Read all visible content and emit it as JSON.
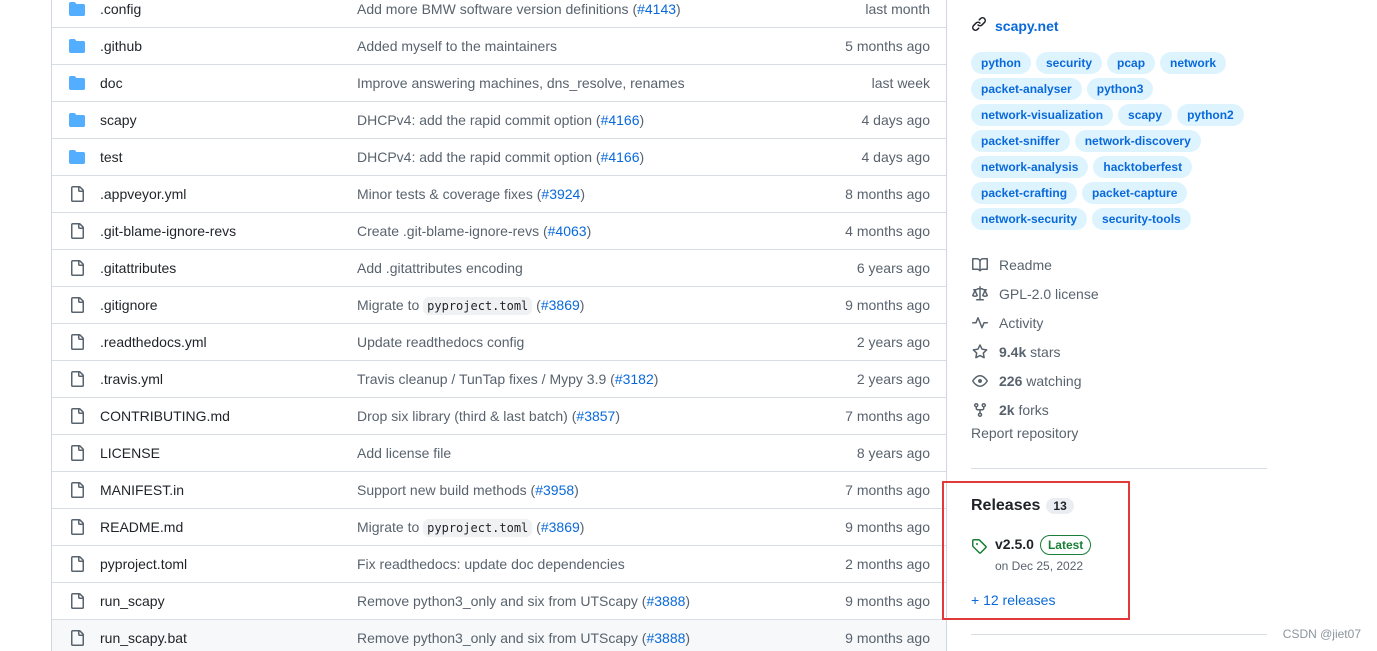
{
  "files": [
    {
      "type": "folder",
      "name": ".config",
      "msg_pre": "Add more BMW software version definitions (",
      "link": "#4143",
      "msg_post": ")",
      "code": "",
      "time": "last month"
    },
    {
      "type": "folder",
      "name": ".github",
      "msg_pre": "Added myself to the maintainers",
      "link": "",
      "msg_post": "",
      "code": "",
      "time": "5 months ago"
    },
    {
      "type": "folder",
      "name": "doc",
      "msg_pre": "Improve answering machines, dns_resolve, renames",
      "link": "",
      "msg_post": "",
      "code": "",
      "time": "last week"
    },
    {
      "type": "folder",
      "name": "scapy",
      "msg_pre": "DHCPv4: add the rapid commit option (",
      "link": "#4166",
      "msg_post": ")",
      "code": "",
      "time": "4 days ago"
    },
    {
      "type": "folder",
      "name": "test",
      "msg_pre": "DHCPv4: add the rapid commit option (",
      "link": "#4166",
      "msg_post": ")",
      "code": "",
      "time": "4 days ago"
    },
    {
      "type": "file",
      "name": ".appveyor.yml",
      "msg_pre": "Minor tests & coverage fixes (",
      "link": "#3924",
      "msg_post": ")",
      "code": "",
      "time": "8 months ago"
    },
    {
      "type": "file",
      "name": ".git-blame-ignore-revs",
      "msg_pre": "Create .git-blame-ignore-revs (",
      "link": "#4063",
      "msg_post": ")",
      "code": "",
      "time": "4 months ago"
    },
    {
      "type": "file",
      "name": ".gitattributes",
      "msg_pre": "Add .gitattributes encoding",
      "link": "",
      "msg_post": "",
      "code": "",
      "time": "6 years ago"
    },
    {
      "type": "file",
      "name": ".gitignore",
      "msg_pre": "Migrate to ",
      "code": "pyproject.toml",
      "link": "#3869",
      "msg_post": ")",
      "time": "9 months ago"
    },
    {
      "type": "file",
      "name": ".readthedocs.yml",
      "msg_pre": "Update readthedocs config",
      "link": "",
      "msg_post": "",
      "code": "",
      "time": "2 years ago"
    },
    {
      "type": "file",
      "name": ".travis.yml",
      "msg_pre": "Travis cleanup / TunTap fixes / Mypy 3.9 (",
      "link": "#3182",
      "msg_post": ")",
      "code": "",
      "time": "2 years ago"
    },
    {
      "type": "file",
      "name": "CONTRIBUTING.md",
      "msg_pre": "Drop six library (third & last batch) (",
      "link": "#3857",
      "msg_post": ")",
      "code": "",
      "time": "7 months ago"
    },
    {
      "type": "file",
      "name": "LICENSE",
      "msg_pre": "Add license file",
      "link": "",
      "msg_post": "",
      "code": "",
      "time": "8 years ago"
    },
    {
      "type": "file",
      "name": "MANIFEST.in",
      "msg_pre": "Support new build methods (",
      "link": "#3958",
      "msg_post": ")",
      "code": "",
      "time": "7 months ago"
    },
    {
      "type": "file",
      "name": "README.md",
      "msg_pre": "Migrate to ",
      "code": "pyproject.toml",
      "link": "#3869",
      "msg_post": ")",
      "time": "9 months ago"
    },
    {
      "type": "file",
      "name": "pyproject.toml",
      "msg_pre": "Fix readthedocs: update doc dependencies",
      "link": "",
      "msg_post": "",
      "code": "",
      "time": "2 months ago"
    },
    {
      "type": "file",
      "name": "run_scapy",
      "msg_pre": "Remove python3_only and six from UTScapy (",
      "link": "#3888",
      "msg_post": ")",
      "code": "",
      "time": "9 months ago"
    },
    {
      "type": "file",
      "name": "run_scapy.bat",
      "msg_pre": "Remove python3_only and six from UTScapy (",
      "link": "#3888",
      "msg_post": ")",
      "code": "",
      "time": "9 months ago"
    }
  ],
  "sidebar": {
    "website": "scapy.net",
    "topics": [
      "python",
      "security",
      "pcap",
      "network",
      "packet-analyser",
      "python3",
      "network-visualization",
      "scapy",
      "python2",
      "packet-sniffer",
      "network-discovery",
      "network-analysis",
      "hacktoberfest",
      "packet-crafting",
      "packet-capture",
      "network-security",
      "security-tools"
    ],
    "meta": {
      "readme": "Readme",
      "license": "GPL-2.0 license",
      "activity": "Activity",
      "stars_count": "9.4k",
      "stars_label": "stars",
      "watching_count": "226",
      "watching_label": "watching",
      "forks_count": "2k",
      "forks_label": "forks"
    },
    "report": "Report repository"
  },
  "releases": {
    "title": "Releases",
    "count": "13",
    "version": "v2.5.0",
    "badge": "Latest",
    "date": "on Dec 25, 2022",
    "more": "+ 12 releases"
  },
  "watermark": "CSDN @jiet07",
  "colors": {
    "accent": "#0969da",
    "folder": "#54aeff",
    "highlight": "#e23a3a",
    "success": "#1a7f37"
  }
}
